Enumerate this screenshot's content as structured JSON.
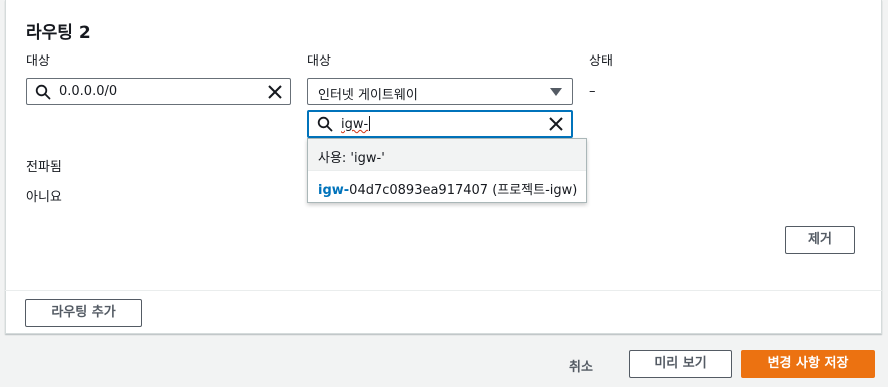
{
  "section": {
    "title": "라우팅 2"
  },
  "columns": {
    "destination_label": "대상",
    "target_label": "대상",
    "status_label": "상태"
  },
  "destination_input": {
    "value": "0.0.0.0/0",
    "icon": "search-icon"
  },
  "target_select": {
    "selected": "인터넷 게이트웨이"
  },
  "status_value": "–",
  "target_search": {
    "value": "igw-"
  },
  "dropdown": {
    "use_option": "사용: 'igw-'",
    "option_prefix": "igw-",
    "option_rest": "04d7c0893ea917407 (프로젝트-igw)"
  },
  "propagated": {
    "label": "전파됨",
    "value": "아니요"
  },
  "remove_button": "제거",
  "add_route_button": "라우팅 추가",
  "footer": {
    "cancel": "취소",
    "preview": "미리 보기",
    "save": "변경 사항 저장"
  },
  "colors": {
    "accent": "#0073bb",
    "primary_button": "#ec7211"
  }
}
